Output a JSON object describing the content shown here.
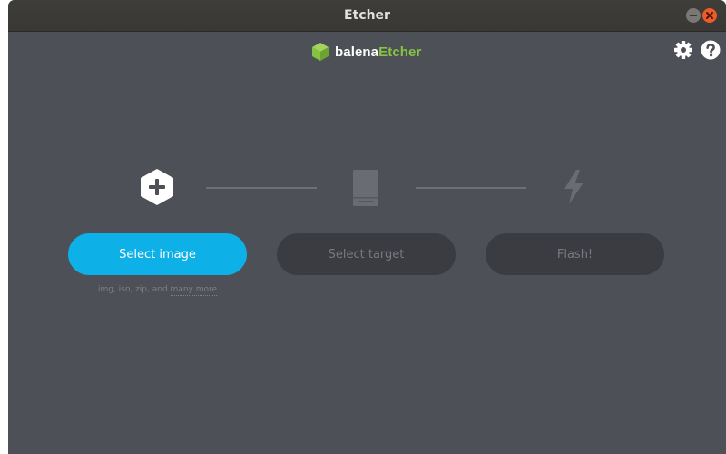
{
  "window": {
    "title": "Etcher"
  },
  "logo": {
    "part1": "balena",
    "part2": "Etcher",
    "accent_color": "#85c440"
  },
  "header_icons": [
    "gear-icon",
    "help-icon"
  ],
  "steps": [
    {
      "icon": "plus-hexagon-icon",
      "button_label": "Select image",
      "state": "active",
      "color": "#0db1e7"
    },
    {
      "icon": "drive-icon",
      "button_label": "Select target",
      "state": "disabled"
    },
    {
      "icon": "flash-icon",
      "button_label": "Flash!",
      "state": "disabled"
    }
  ],
  "hint": {
    "prefix": "img, iso, zip, and",
    "link": "many more"
  }
}
